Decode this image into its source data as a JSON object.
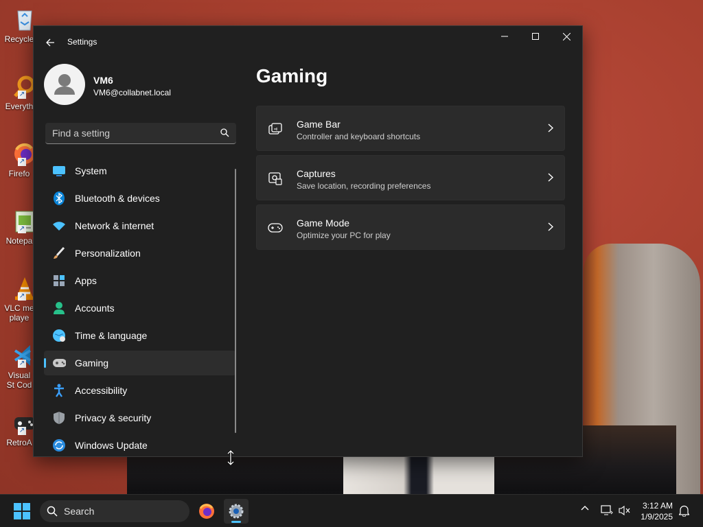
{
  "desktop": {
    "icons": [
      {
        "label": "Recycle",
        "icon": "recycle-bin-icon"
      },
      {
        "label": "Everyth",
        "icon": "everything-search-icon"
      },
      {
        "label": "Firefo",
        "icon": "firefox-icon"
      },
      {
        "label": "Notepa",
        "icon": "notepad-icon"
      },
      {
        "label": "VLC me playe",
        "icon": "vlc-icon"
      },
      {
        "label": "Visual St Cod",
        "icon": "vscode-icon"
      },
      {
        "label": "RetroA",
        "icon": "retroarch-icon"
      }
    ]
  },
  "window": {
    "title": "Settings",
    "user": {
      "name": "VM6",
      "email": "VM6@collabnet.local"
    },
    "search": {
      "placeholder": "Find a setting"
    },
    "nav": [
      {
        "label": "System",
        "icon": "system-monitor-icon",
        "color": "#4cc2ff"
      },
      {
        "label": "Bluetooth & devices",
        "icon": "bluetooth-icon",
        "color": "#0a84d8"
      },
      {
        "label": "Network & internet",
        "icon": "wifi-icon",
        "color": "#4cc2ff"
      },
      {
        "label": "Personalization",
        "icon": "brush-icon",
        "color": "#e0a060"
      },
      {
        "label": "Apps",
        "icon": "apps-icon",
        "color": "#9aa7b8"
      },
      {
        "label": "Accounts",
        "icon": "accounts-icon",
        "color": "#27c08a"
      },
      {
        "label": "Time & language",
        "icon": "globe-clock-icon",
        "color": "#4cc2ff"
      },
      {
        "label": "Gaming",
        "icon": "gamepad-icon",
        "color": "#c9c9c9",
        "active": true
      },
      {
        "label": "Accessibility",
        "icon": "accessibility-icon",
        "color": "#3aa0ff"
      },
      {
        "label": "Privacy & security",
        "icon": "shield-icon",
        "color": "#9aa0a6"
      },
      {
        "label": "Windows Update",
        "icon": "update-icon",
        "color": "#2a8cdf"
      }
    ],
    "page_title": "Gaming",
    "cards": [
      {
        "title": "Game Bar",
        "subtitle": "Controller and keyboard shortcuts",
        "icon": "game-bar-icon"
      },
      {
        "title": "Captures",
        "subtitle": "Save location, recording preferences",
        "icon": "captures-icon"
      },
      {
        "title": "Game Mode",
        "subtitle": "Optimize your PC for play",
        "icon": "game-mode-icon"
      }
    ]
  },
  "taskbar": {
    "search_label": "Search",
    "apps": [
      {
        "name": "firefox",
        "icon": "firefox-icon"
      },
      {
        "name": "settings",
        "icon": "settings-gear-icon",
        "active": true
      }
    ],
    "time": "3:12 AM",
    "date": "1/9/2025"
  }
}
